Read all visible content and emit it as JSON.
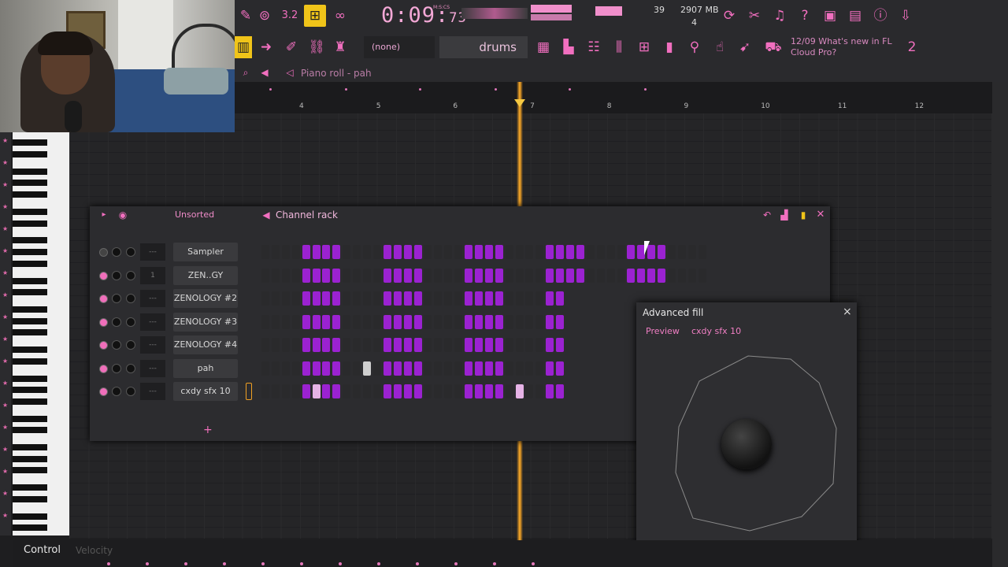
{
  "toolbar": {
    "time_main": "0:09",
    "time_frac": "73",
    "time_unit": "M:S:CS",
    "cpu": "39",
    "memory": "2907 MB",
    "polyphony": "4",
    "pattern_selector": "(none)",
    "pattern_name": "drums",
    "news_date": "12/09",
    "news_text": "What's new in FL Cloud Pro?",
    "news_count": "2",
    "icons": [
      "metronome-icon",
      "record-icon",
      "countdown-icon",
      "step-edit-icon",
      "loop-icon",
      "typing-keyboard-icon",
      "arrow-icon",
      "brush-icon",
      "link-icon",
      "stamp-icon",
      "playlist-icon",
      "piano-roll-icon",
      "channel-rack-icon",
      "mixer-icon",
      "browser-icon",
      "plugin-icon",
      "touch-icon",
      "cut-icon",
      "microphone-icon",
      "help-icon",
      "save-icon",
      "render-icon",
      "info-icon",
      "download-icon",
      "refresh-icon"
    ]
  },
  "piano_roll": {
    "title": "Piano roll - pah",
    "bars": [
      "4",
      "5",
      "6",
      "7",
      "8",
      "9",
      "10",
      "11",
      "12"
    ]
  },
  "channel_rack": {
    "filter": "Unsorted",
    "title": "Channel rack",
    "channels": [
      {
        "name": "Sampler"
      },
      {
        "name": "ZEN..GY"
      },
      {
        "name": "ZENOLOGY #2"
      },
      {
        "name": "ZENOLOGY #3"
      },
      {
        "name": "ZENOLOGY #4"
      },
      {
        "name": "pah"
      },
      {
        "name": "cxdy sfx 10"
      }
    ],
    "mix_label": "---",
    "add_label": "+"
  },
  "advanced_fill": {
    "title": "Advanced fill",
    "preview_label": "Preview",
    "target": "cxdy sfx 10",
    "close": "×"
  },
  "control_bar": {
    "label": "Control",
    "sub": "Velocity"
  },
  "colors": {
    "accent": "#f06fbb",
    "step_on": "#9b22d1",
    "step_off": "#2a2a2c",
    "playhead": "#f0a023"
  }
}
